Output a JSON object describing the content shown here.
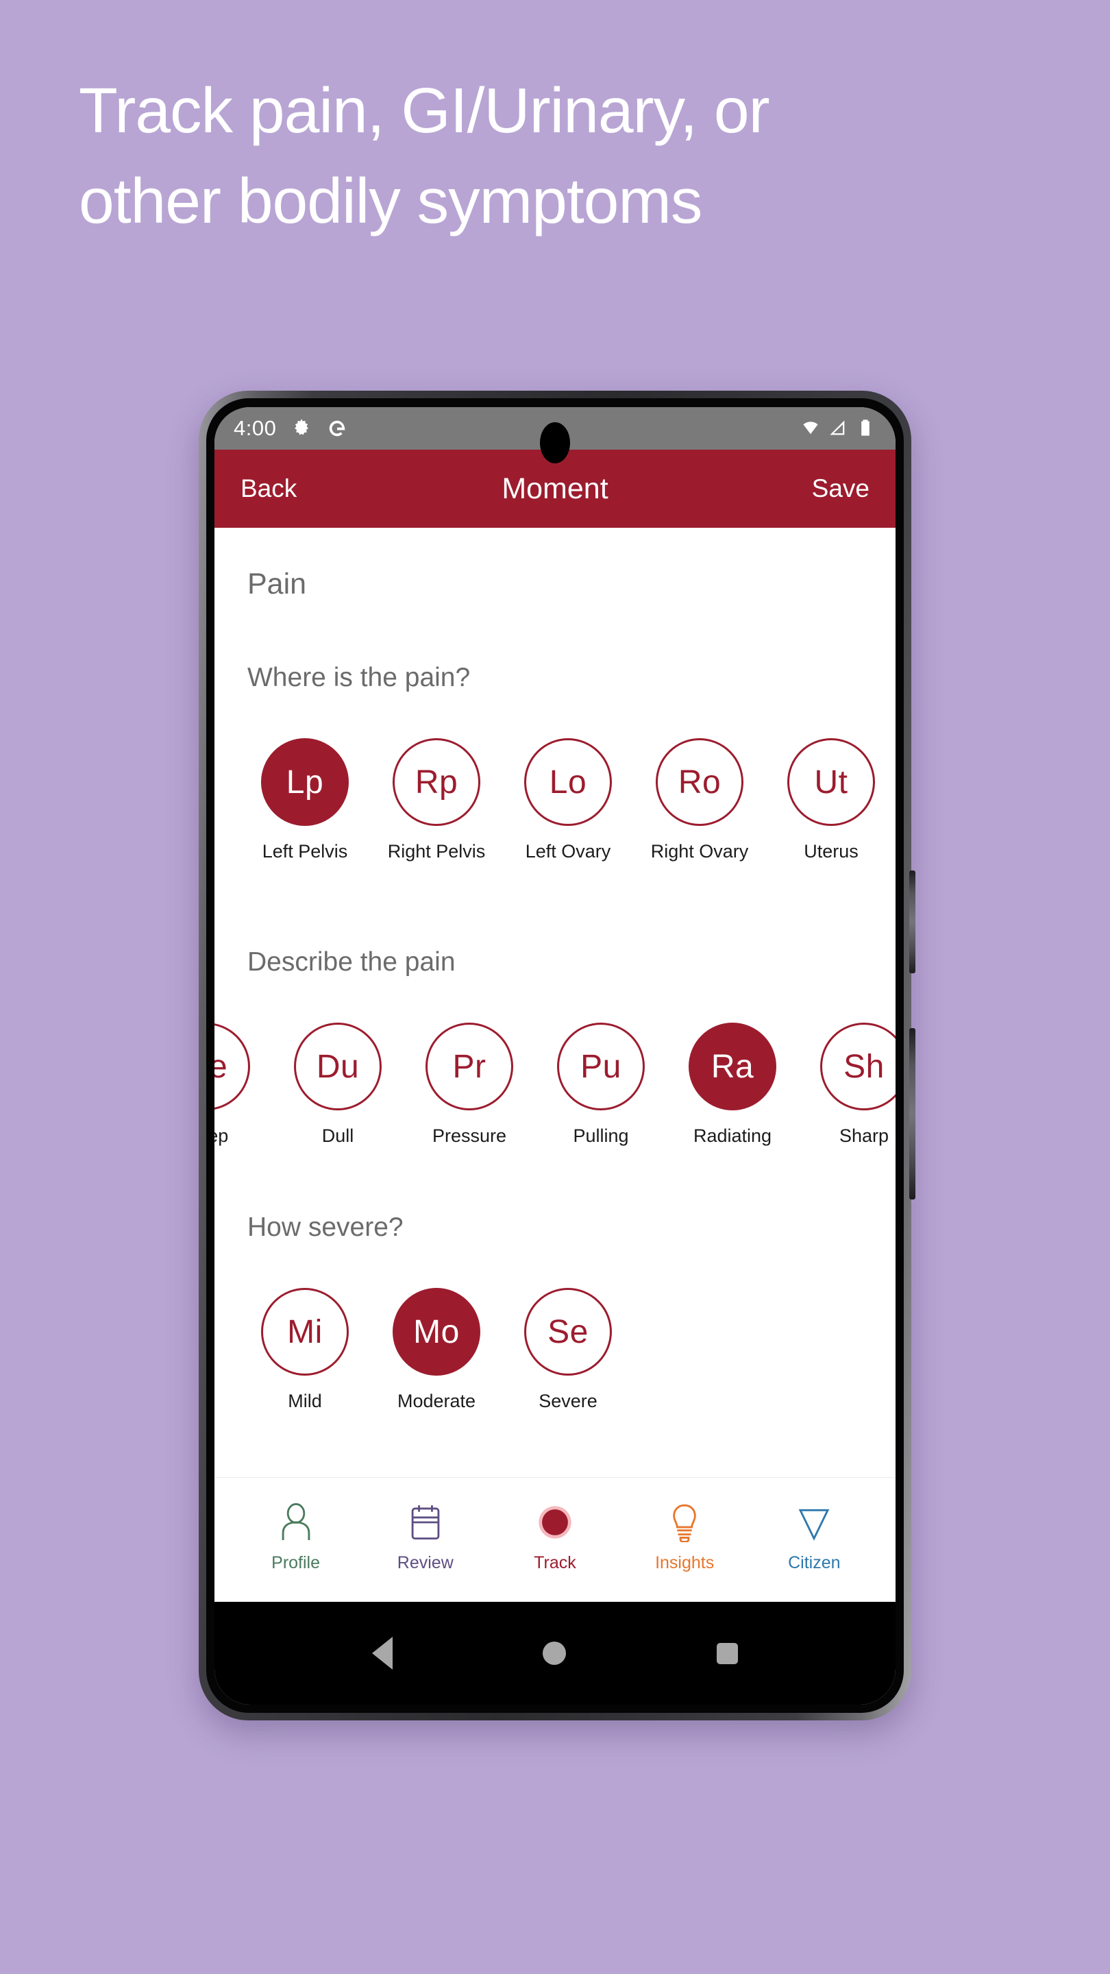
{
  "promo": {
    "line1": "Track pain, GI/Urinary, or",
    "line2": "other bodily symptoms",
    "background_color": "#b8a5d4",
    "text_color": "#ffffff"
  },
  "theme": {
    "accent_red": "#9c1c2e",
    "status_bar_gray": "#7a7a7a",
    "muted_text": "#6b6b6b"
  },
  "status_bar": {
    "time": "4:00",
    "left_icons": [
      "gear-icon",
      "google-g-icon"
    ],
    "right_icons": [
      "wifi-icon",
      "cellular-signal-icon",
      "battery-icon"
    ]
  },
  "app_bar": {
    "back_label": "Back",
    "title": "Moment",
    "save_label": "Save"
  },
  "screen": {
    "section_title": "Pain",
    "groups": [
      {
        "question": "Where is the pain?",
        "scrolled": false,
        "options": [
          {
            "abbr": "Lp",
            "label": "Left Pelvis",
            "selected": true
          },
          {
            "abbr": "Rp",
            "label": "Right Pelvis",
            "selected": false
          },
          {
            "abbr": "Lo",
            "label": "Left Ovary",
            "selected": false
          },
          {
            "abbr": "Ro",
            "label": "Right Ovary",
            "selected": false
          },
          {
            "abbr": "Ut",
            "label": "Uterus",
            "selected": false
          }
        ]
      },
      {
        "question": "Describe the pain",
        "scrolled": true,
        "options": [
          {
            "abbr": "De",
            "label": "Deep",
            "selected": false
          },
          {
            "abbr": "Du",
            "label": "Dull",
            "selected": false
          },
          {
            "abbr": "Pr",
            "label": "Pressure",
            "selected": false
          },
          {
            "abbr": "Pu",
            "label": "Pulling",
            "selected": false
          },
          {
            "abbr": "Ra",
            "label": "Radiating",
            "selected": true
          },
          {
            "abbr": "Sh",
            "label": "Sharp",
            "selected": false
          }
        ]
      },
      {
        "question": "How severe?",
        "scrolled": false,
        "options": [
          {
            "abbr": "Mi",
            "label": "Mild",
            "selected": false
          },
          {
            "abbr": "Mo",
            "label": "Moderate",
            "selected": true
          },
          {
            "abbr": "Se",
            "label": "Severe",
            "selected": false
          }
        ]
      }
    ]
  },
  "bottom_nav": {
    "items": [
      {
        "label": "Profile",
        "icon": "person-icon",
        "color": "#4a7a5e",
        "active": false
      },
      {
        "label": "Review",
        "icon": "calendar-icon",
        "color": "#5d4e82",
        "active": false
      },
      {
        "label": "Track",
        "icon": "record-icon",
        "color": "#9c1c2e",
        "active": true
      },
      {
        "label": "Insights",
        "icon": "lightbulb-icon",
        "color": "#e8762c",
        "active": false
      },
      {
        "label": "Citizen",
        "icon": "triangle-icon",
        "color": "#2e79ad",
        "active": false
      }
    ]
  },
  "android_nav": {
    "buttons": [
      "back-triangle-icon",
      "home-circle-icon",
      "recents-square-icon"
    ]
  }
}
